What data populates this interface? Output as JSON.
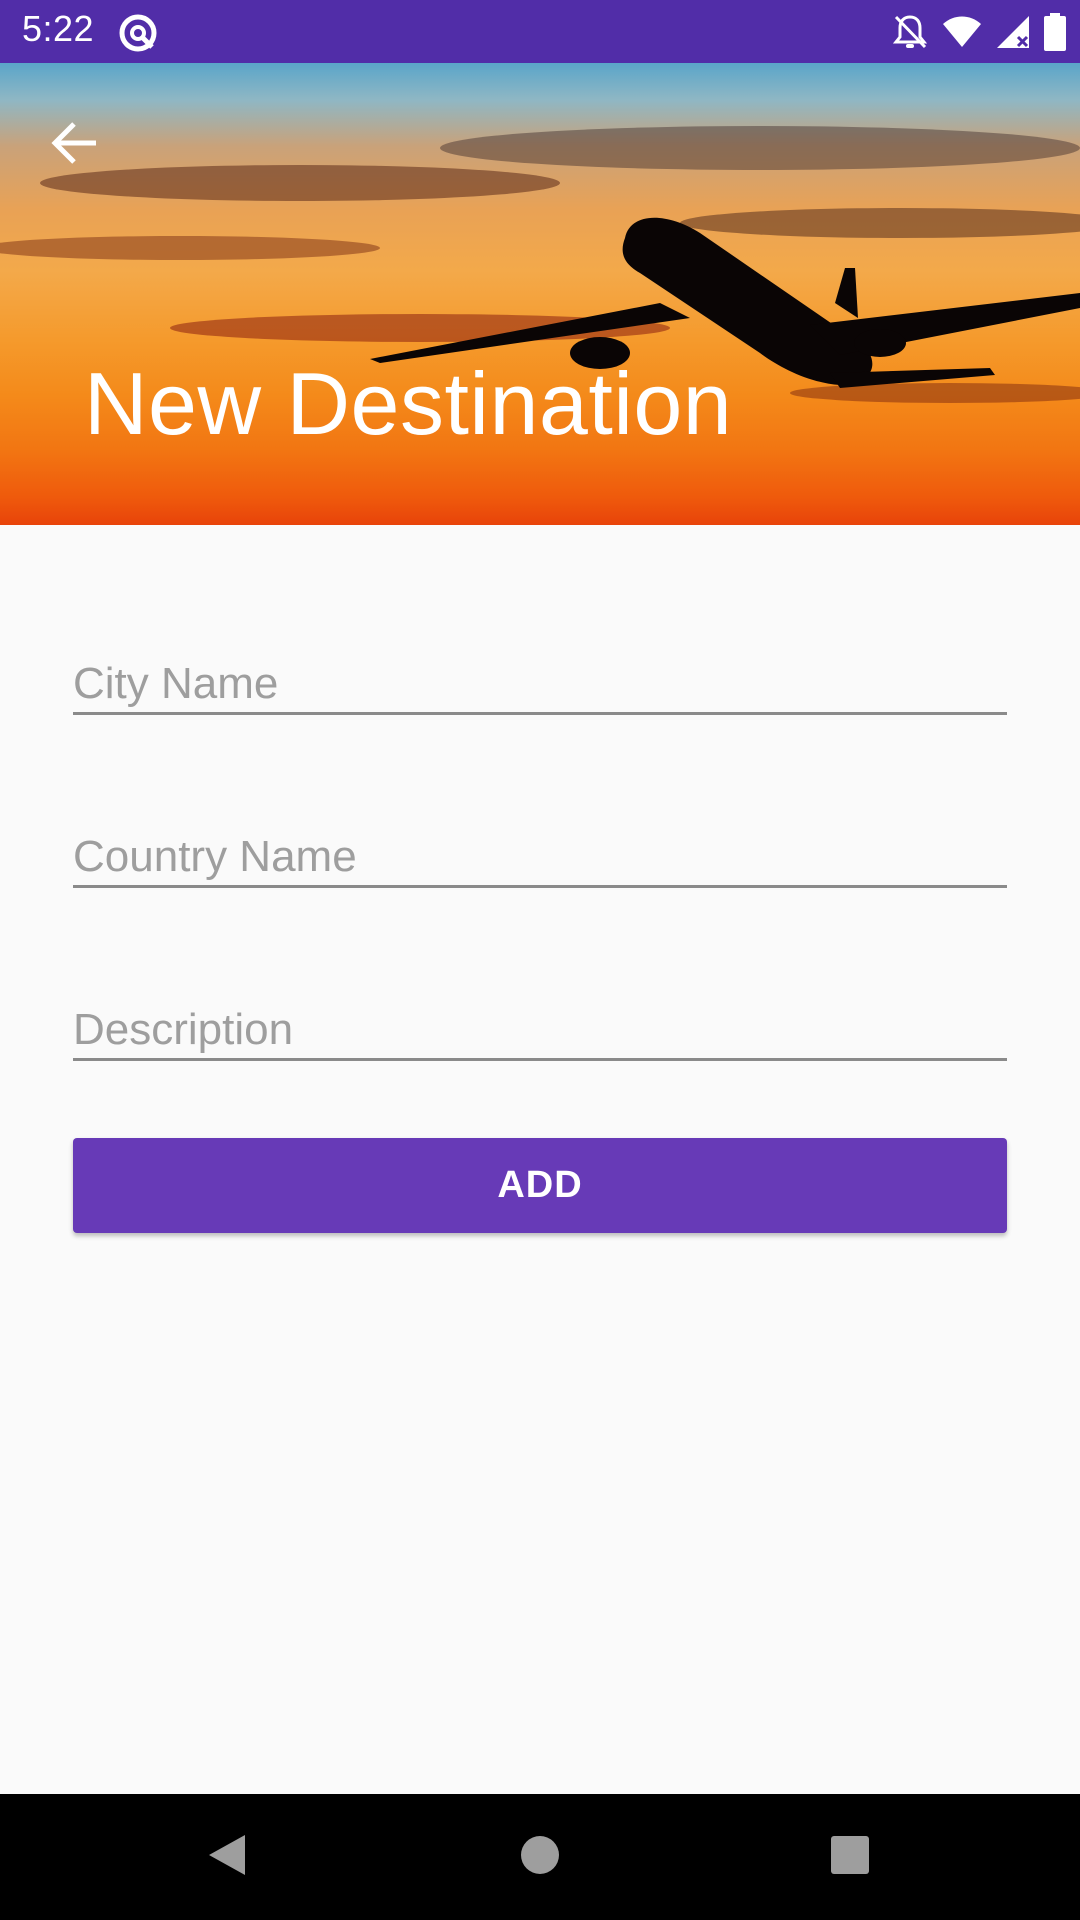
{
  "status_bar": {
    "time": "5:22",
    "icons": [
      "app-notification-icon",
      "notifications-off-icon",
      "wifi-icon",
      "cell-signal-icon",
      "battery-icon"
    ]
  },
  "header": {
    "title": "New Destination",
    "back_icon": "arrow-back-icon",
    "image": "sunset-airplane-image"
  },
  "form": {
    "city": {
      "placeholder": "City Name",
      "value": ""
    },
    "country": {
      "placeholder": "Country Name",
      "value": ""
    },
    "description": {
      "placeholder": "Description",
      "value": ""
    },
    "add_label": "ADD"
  },
  "nav_bar": {
    "icons": [
      "nav-back-icon",
      "nav-home-icon",
      "nav-recents-icon"
    ]
  },
  "colors": {
    "status_bar": "#512da8",
    "accent": "#673ab7",
    "background": "#fafafa"
  }
}
